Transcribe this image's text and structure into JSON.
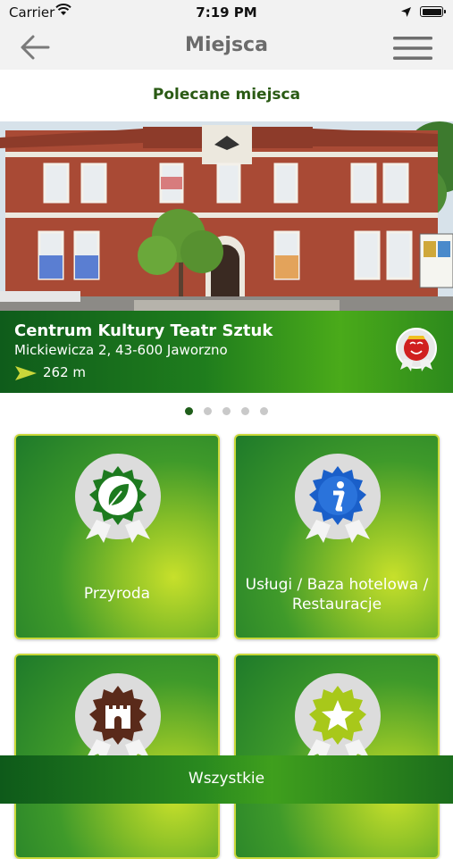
{
  "status_bar": {
    "carrier": "Carrier",
    "time": "7:19 PM"
  },
  "nav": {
    "title": "Miejsca",
    "back_icon": "arrow-left-icon",
    "menu_icon": "hamburger-menu-icon"
  },
  "featured": {
    "section_title": "Polecane miejsca",
    "name": "Centrum Kultury Teatr Sztuk",
    "address": "Mickiewicza 2, 43-600 Jaworzno",
    "distance": "262 m",
    "category_icon": "theater-masks-icon",
    "carousel": {
      "count": 5,
      "active": 1
    }
  },
  "categories": [
    {
      "label": "Przyroda",
      "icon": "leaf-icon",
      "color": "#1e7a1e"
    },
    {
      "label": "Usługi / Baza hotelowa / Restauracje",
      "icon": "info-icon",
      "color": "#1a5fc9"
    },
    {
      "label": "",
      "icon": "castle-icon",
      "color": "#5a2a1a"
    },
    {
      "label": "",
      "icon": "star-icon",
      "color": "#a8c81a"
    }
  ],
  "bottom_button": {
    "label": "Wszystkie"
  },
  "colors": {
    "brand_green": "#1f7d1d",
    "title_green": "#2a5a14",
    "accent_lime": "#c7e02b"
  }
}
